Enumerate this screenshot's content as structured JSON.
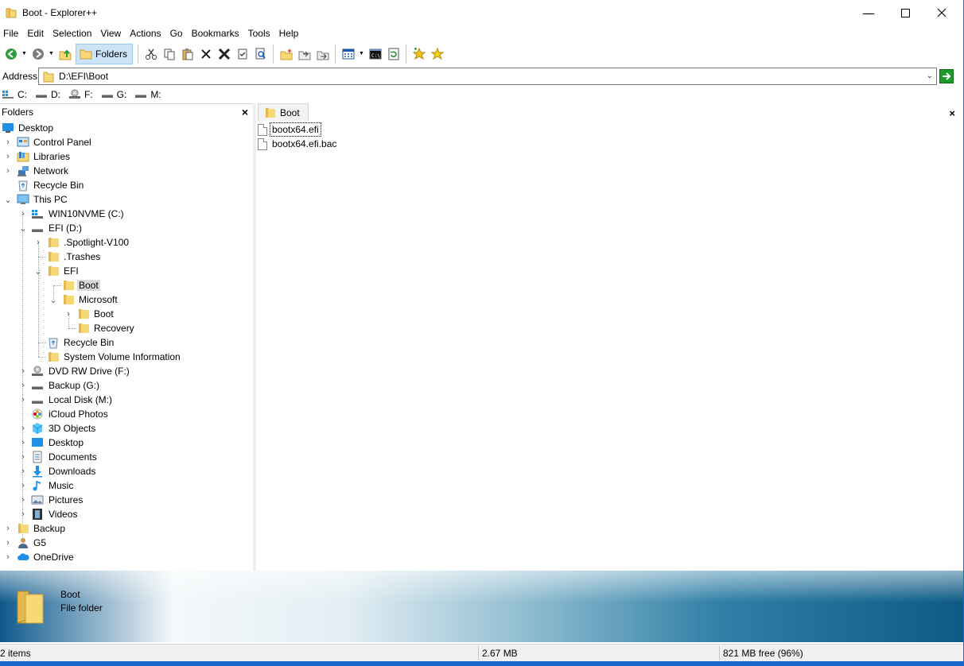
{
  "window": {
    "title": "Boot - Explorer++"
  },
  "menu": [
    "File",
    "Edit",
    "Selection",
    "View",
    "Actions",
    "Go",
    "Bookmarks",
    "Tools",
    "Help"
  ],
  "toolbar": {
    "folders_label": "Folders"
  },
  "address": {
    "label": "Address",
    "path": "D:\\EFI\\Boot"
  },
  "drives": [
    "C:",
    "D:",
    "F:",
    "G:",
    "M:"
  ],
  "folders_pane": {
    "title": "Folders",
    "tree": [
      "Desktop",
      "Control Panel",
      "Libraries",
      "Network",
      "Recycle Bin",
      "This PC",
      "WIN10NVME (C:)",
      "EFI (D:)",
      ".Spotlight-V100",
      ".Trashes",
      "EFI",
      "Boot",
      "Microsoft",
      "Boot",
      "Recovery",
      "Recycle Bin",
      "System Volume Information",
      "DVD RW Drive (F:)",
      "Backup (G:)",
      "Local Disk (M:)",
      "iCloud Photos",
      "3D Objects",
      "Desktop",
      "Documents",
      "Downloads",
      "Music",
      "Pictures",
      "Videos",
      "Backup",
      "G5",
      "OneDrive"
    ]
  },
  "tab": {
    "label": "Boot"
  },
  "files": [
    "bootx64.efi",
    "bootx64.efi.bac"
  ],
  "info": {
    "name": "Boot",
    "type": "File folder"
  },
  "status": {
    "items": "2 items",
    "size": "2.67 MB",
    "free": "821 MB free (96%)"
  },
  "colors": {
    "accent": "#1b66c9",
    "folder": "#f8d775",
    "selection": "#cce4f7"
  }
}
